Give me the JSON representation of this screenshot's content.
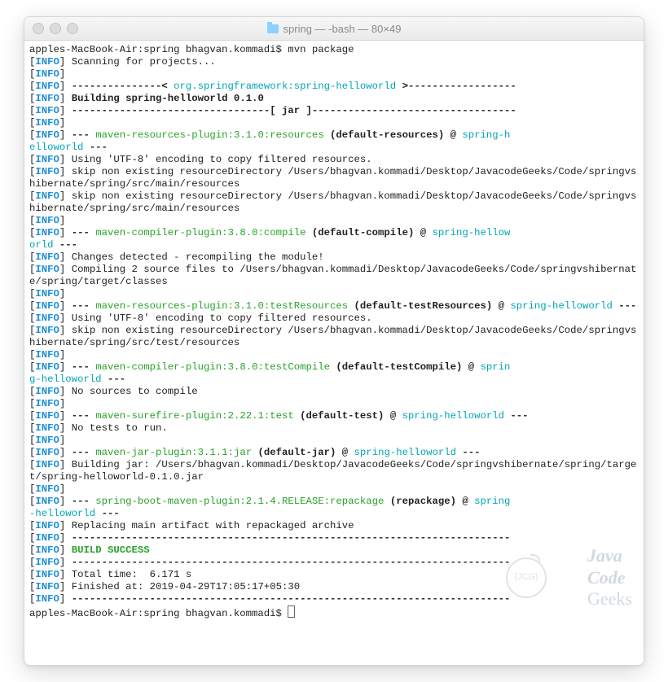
{
  "window": {
    "title": "spring — -bash — 80×49"
  },
  "prompt": {
    "line1": "apples-MacBook-Air:spring bhagvan.kommadi$ mvn package",
    "line2": "apples-MacBook-Air:spring bhagvan.kommadi$ "
  },
  "info_tag": "INFO",
  "lines": {
    "scanning": " Scanning for projects...",
    "dashes1": " ---------------< ",
    "artifact": "org.springframework:spring-helloworld",
    "dashes1b": " >------------------",
    "building": " Building spring-helloworld 0.1.0",
    "jar_line": " ---------------------------------[ jar ]----------------------------------",
    "plug_res": "maven-resources-plugin:3.1.0:resources",
    "goal_res": " (default-resources)",
    "at": " @ ",
    "proj": "spring-helloworld",
    "proj_wrap": "spring-h\nelloworld",
    "utf8": " Using 'UTF-8' encoding to copy filtered resources.",
    "skip1": " skip non existing resourceDirectory /Users/bhagvan.kommadi/Desktop/JavacodeGeeks/Code/springvshibernate/spring/src/main/resources",
    "skip2": " skip non existing resourceDirectory /Users/bhagvan.kommadi/Desktop/JavacodeGeeks/Code/springvshibernate/spring/src/main/resources",
    "plug_comp": "maven-compiler-plugin:3.8.0:compile",
    "goal_comp": " (default-compile)",
    "proj_wrap2": "spring-hellow\norld",
    "changes": " Changes detected - recompiling the module!",
    "compiling": " Compiling 2 source files to /Users/bhagvan.kommadi/Desktop/JavacodeGeeks/Code/springvshibernate/spring/target/classes",
    "plug_tres": "maven-resources-plugin:3.1.0:testResources",
    "goal_tres": " (default-testResources)",
    "skip3": " skip non existing resourceDirectory /Users/bhagvan.kommadi/Desktop/JavacodeGeeks/Code/springvshibernate/spring/src/test/resources",
    "plug_tcomp": "maven-compiler-plugin:3.8.0:testCompile",
    "goal_tcomp": " (default-testCompile)",
    "proj_wrap3": "sprin\ng-helloworld",
    "nosrc": " No sources to compile",
    "plug_test": "maven-surefire-plugin:2.22.1:test",
    "goal_test": " (default-test)",
    "notests": " No tests to run.",
    "plug_jar": "maven-jar-plugin:3.1.1:jar",
    "goal_jar": " (default-jar)",
    "buildjar": " Building jar: /Users/bhagvan.kommadi/Desktop/JavacodeGeeks/Code/springvshibernate/spring/target/spring-helloworld-0.1.0.jar",
    "plug_boot": "spring-boot-maven-plugin:2.1.4.RELEASE:repackage",
    "goal_boot": " (repackage)",
    "proj_wrap4": "spring\n-helloworld",
    "replacing": " Replacing main artifact with repackaged archive",
    "sep": " -------------------------------------------------------------------------",
    "success": " BUILD SUCCESS",
    "total": " Total time:  6.171 s",
    "finished": " Finished at: 2019-04-29T17:05:17+05:30",
    "dash3": " --- ",
    "dash3e": " ---"
  },
  "watermark": {
    "badge": "{JCG}",
    "text1": "Java",
    "text2": "Code",
    "text3": "Geeks"
  }
}
